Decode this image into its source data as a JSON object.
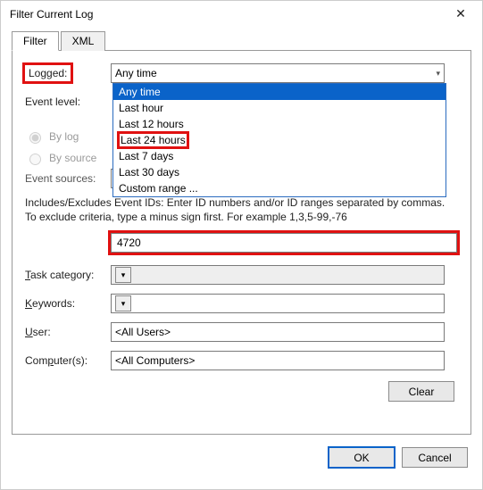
{
  "window": {
    "title": "Filter Current Log"
  },
  "tabs": {
    "filter": "Filter",
    "xml": "XML"
  },
  "labels": {
    "logged": "Logged:",
    "eventlevel": "Event level:",
    "bylog": "By log",
    "bysource": "By source",
    "eventsources": "Event sources:",
    "taskcategory": "Task category:",
    "keywords": "Keywords:",
    "user": "User:",
    "computers": "Computer(s):"
  },
  "logged": {
    "selected": "Any time",
    "options": [
      "Any time",
      "Last hour",
      "Last 12 hours",
      "Last 24 hours",
      "Last 7 days",
      "Last 30 days",
      "Custom range ..."
    ],
    "highlighted": "Last 24 hours"
  },
  "infotext": "Includes/Excludes Event IDs: Enter ID numbers and/or ID ranges separated by commas. To exclude criteria, type a minus sign first. For example 1,3,5-99,-76",
  "eventid": "4720",
  "user": "<All Users>",
  "computers": "<All Computers>",
  "buttons": {
    "clear": "Clear",
    "ok": "OK",
    "cancel": "Cancel"
  }
}
